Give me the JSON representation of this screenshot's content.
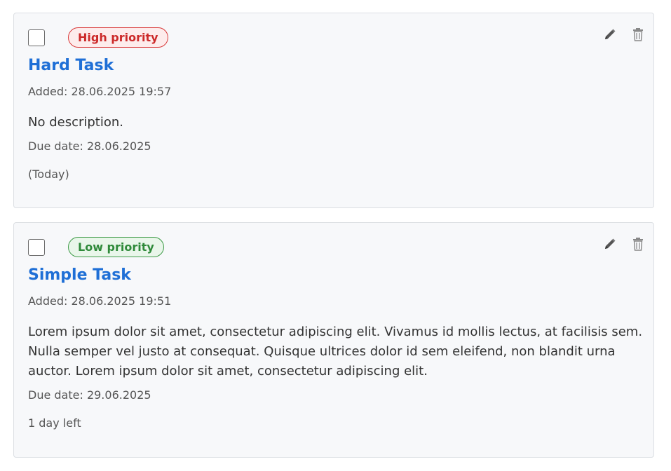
{
  "tasks": [
    {
      "priority_label": "High priority",
      "title": "Hard Task",
      "added": "Added: 28.06.2025 19:57",
      "description": "No description.",
      "due": "Due date: 28.06.2025",
      "remaining": "(Today)",
      "edit_icon": "pencil-icon",
      "delete_icon": "trash-icon"
    },
    {
      "priority_label": "Low priority",
      "title": "Simple Task",
      "added": "Added: 28.06.2025 19:51",
      "description": "Lorem ipsum dolor sit amet, consectetur adipiscing elit. Vivamus id mollis lectus, at facilisis sem. Nulla semper vel justo at consequat. Quisque ultrices dolor id sem eleifend, non blandit urna auctor. Lorem ipsum dolor sit amet, consectetur adipiscing elit.",
      "due": "Due date: 29.06.2025",
      "remaining": "1 day left",
      "edit_icon": "pencil-icon",
      "delete_icon": "trash-icon"
    }
  ],
  "colors": {
    "title": "#1f6fd6",
    "high_priority": "#cc2a2a",
    "low_priority": "#2f8a3a",
    "card_background": "#f7f8fa"
  }
}
